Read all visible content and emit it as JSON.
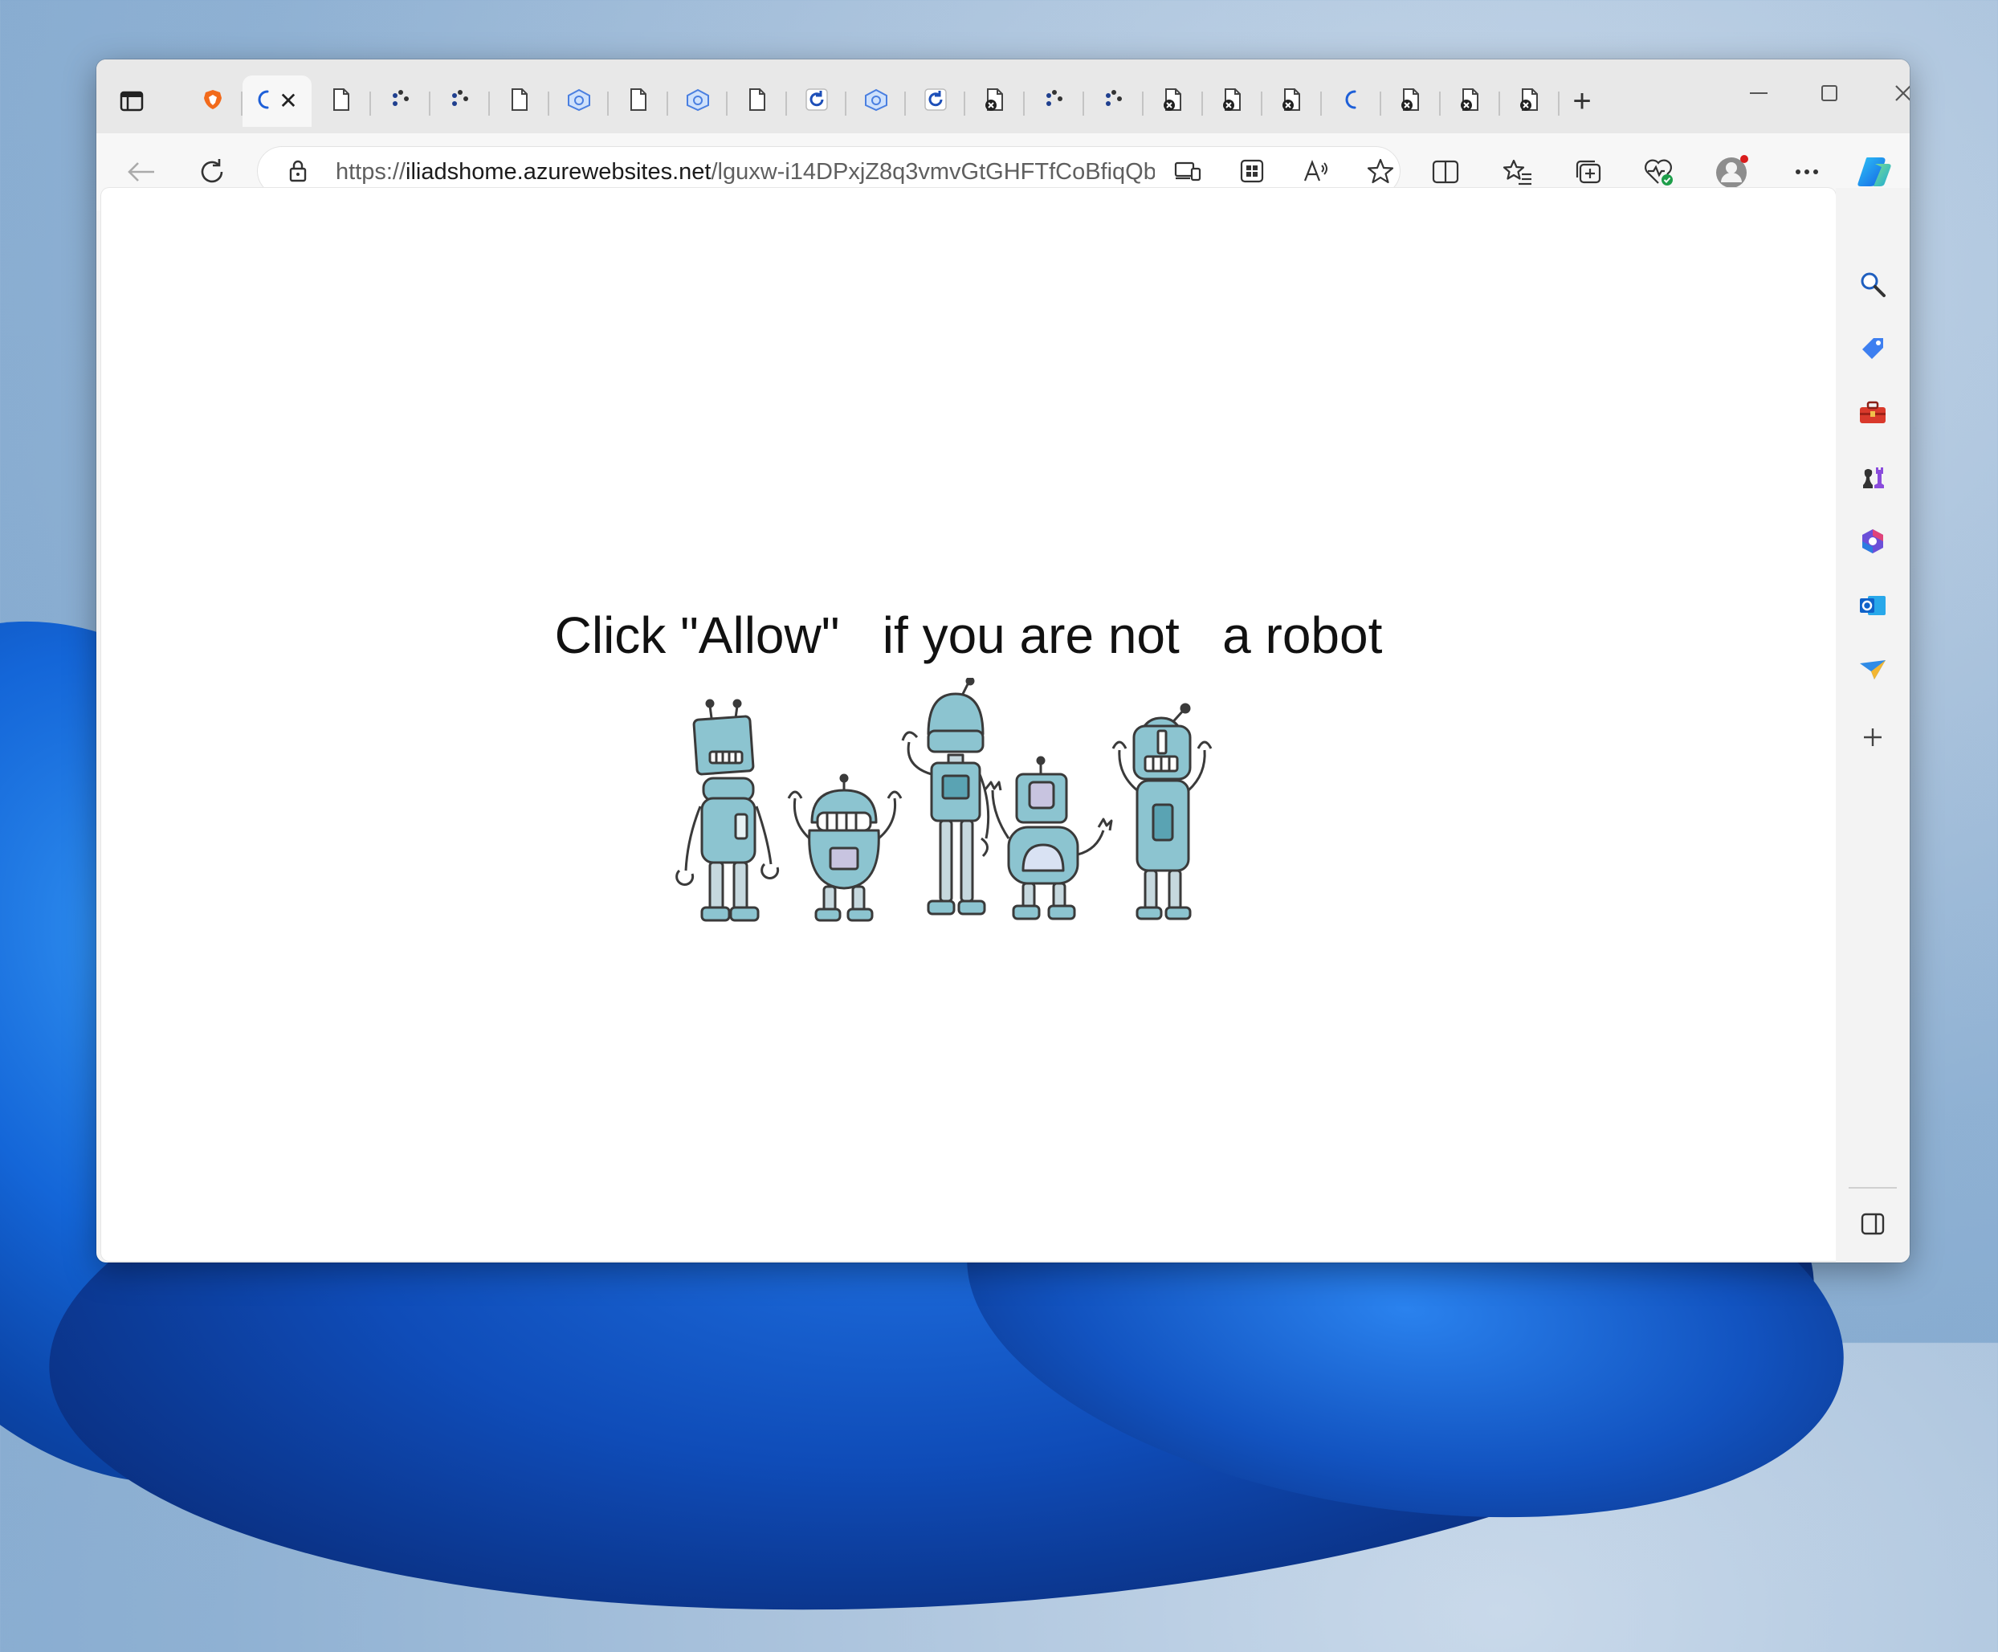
{
  "browser": {
    "tabs": [
      {
        "icon": "brave-icon",
        "active": false
      },
      {
        "icon": "loading-icon",
        "active": true,
        "close_label": "✕"
      },
      {
        "icon": "document-icon"
      },
      {
        "icon": "dots-icon"
      },
      {
        "icon": "dots-icon"
      },
      {
        "icon": "document-icon"
      },
      {
        "icon": "network-icon"
      },
      {
        "icon": "document-icon"
      },
      {
        "icon": "network-icon"
      },
      {
        "icon": "document-icon"
      },
      {
        "icon": "refresh-blue-icon"
      },
      {
        "icon": "network-icon"
      },
      {
        "icon": "refresh-blue-icon"
      },
      {
        "icon": "document-error-icon"
      },
      {
        "icon": "dots-icon"
      },
      {
        "icon": "dots-icon"
      },
      {
        "icon": "document-error-icon"
      },
      {
        "icon": "document-error-icon"
      },
      {
        "icon": "document-error-icon"
      },
      {
        "icon": "loading-icon"
      },
      {
        "icon": "document-error-icon"
      },
      {
        "icon": "document-error-icon"
      },
      {
        "icon": "document-error-icon"
      }
    ],
    "new_tab_label": "+",
    "address": {
      "scheme": "https://",
      "host": "iliadshome.azurewebsites.net",
      "path": "/lguxw-i14DPxjZ8q3vmvGtGHFTfCoBfiqQb..."
    }
  },
  "page": {
    "headline": "Click \"Allow\"   if you are not   a robot",
    "image_alt": "robots"
  },
  "colors": {
    "accent": "#0a5cd8",
    "robot_fill": "#8cc4d0",
    "robot_stroke": "#3a3a3a"
  }
}
